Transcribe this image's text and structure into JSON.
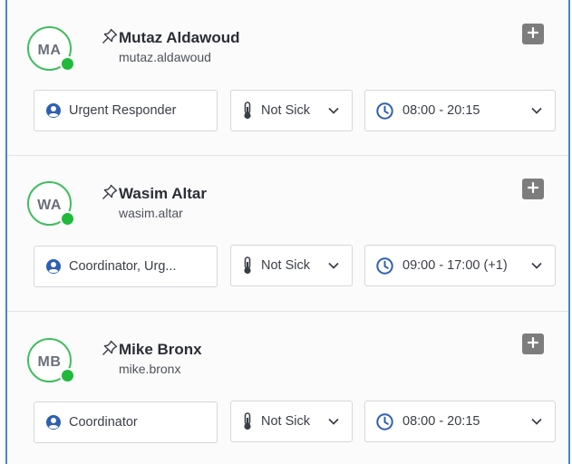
{
  "members": [
    {
      "initials": "MA",
      "name": "Mutaz Aldawoud",
      "username": "mutaz.aldawoud",
      "role": "Urgent Responder",
      "sick_status": "Not Sick",
      "shift": "08:00 - 20:15",
      "online": true
    },
    {
      "initials": "WA",
      "name": "Wasim Altar",
      "username": "wasim.altar",
      "role": "Coordinator, Urg...",
      "sick_status": "Not Sick",
      "shift": "09:00 - 17:00 (+1)",
      "online": true
    },
    {
      "initials": "MB",
      "name": "Mike Bronx",
      "username": "mike.bronx",
      "role": "Coordinator",
      "sick_status": "Not Sick",
      "shift": "08:00 - 20:15",
      "online": true
    }
  ],
  "icons": {
    "pin": "pin-icon",
    "add": "plus-icon",
    "role": "user-circle-icon",
    "sick": "thermometer-icon",
    "shift": "clock-icon",
    "dropdown": "chevron-down-icon"
  },
  "colors": {
    "online": "#1fba3a",
    "avatar_ring": "#3fbd5c",
    "shift_icon": "#2f5fb3",
    "add_button": "#7d7d7d",
    "frame_border": "#4a86c8"
  }
}
